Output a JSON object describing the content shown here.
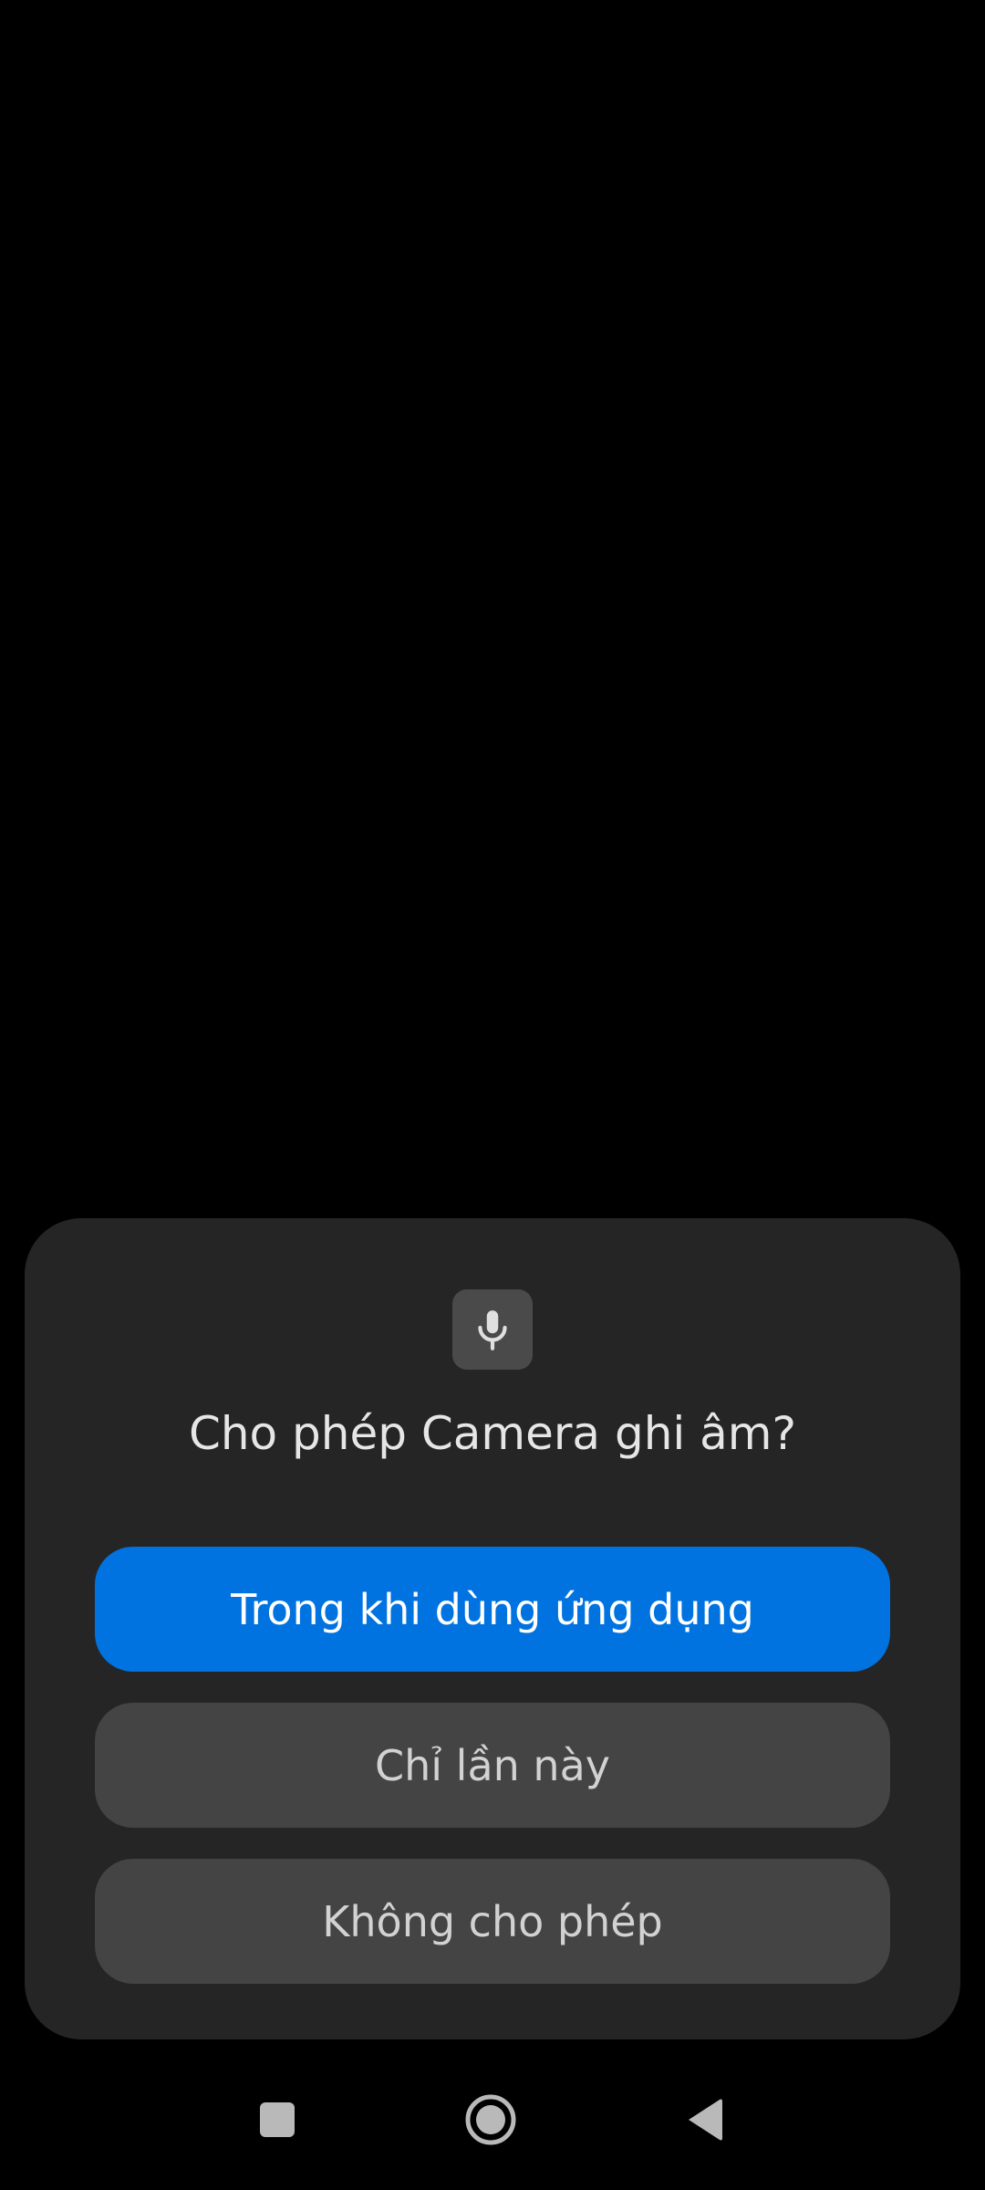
{
  "dialog": {
    "icon": "microphone-icon",
    "title": "Cho phép Camera ghi âm?",
    "buttons": {
      "while_using": "Trong khi dùng ứng dụng",
      "only_this_time": "Chỉ lần này",
      "deny": "Không cho phép"
    }
  },
  "navigation": {
    "recents_icon": "square-icon",
    "home_icon": "circle-home-icon",
    "back_icon": "triangle-back-icon"
  },
  "colors": {
    "background": "#000000",
    "dialog_bg": "#252525",
    "primary_button": "#0073e0",
    "secondary_button": "#444444",
    "icon_box": "#4a4a4a"
  }
}
